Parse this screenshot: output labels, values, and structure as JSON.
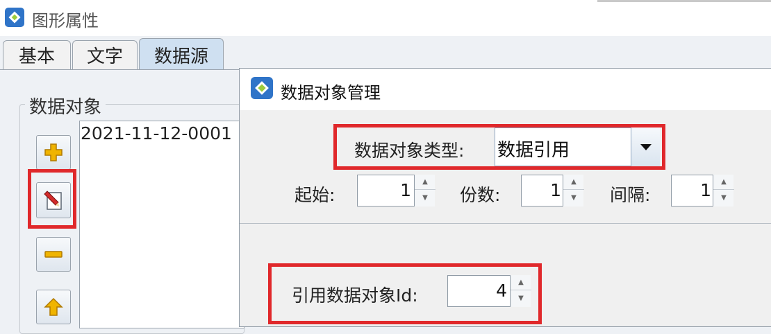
{
  "window": {
    "title": "图形属性"
  },
  "tabs": [
    {
      "label": "基本"
    },
    {
      "label": "文字"
    },
    {
      "label": "数据源"
    }
  ],
  "data_object_panel": {
    "group_title": "数据对象",
    "items": [
      "2021-11-12-0001"
    ],
    "buttons": [
      {
        "icon": "add-icon"
      },
      {
        "icon": "edit-icon"
      },
      {
        "icon": "remove-icon"
      },
      {
        "icon": "move-up-icon"
      }
    ]
  },
  "dialog": {
    "title": "数据对象管理",
    "type_label": "数据对象类型:",
    "type_value": "数据引用",
    "start_label": "起始:",
    "start_value": "1",
    "copies_label": "份数:",
    "copies_value": "1",
    "interval_label": "间隔:",
    "interval_value": "1",
    "ref_label": "引用数据对象Id:",
    "ref_value": "4"
  },
  "colors": {
    "highlight": "#e0282b",
    "active_tab": "#cfe0f1",
    "add_icon": "#f0b400",
    "edit_icon": "#d22b2b"
  }
}
